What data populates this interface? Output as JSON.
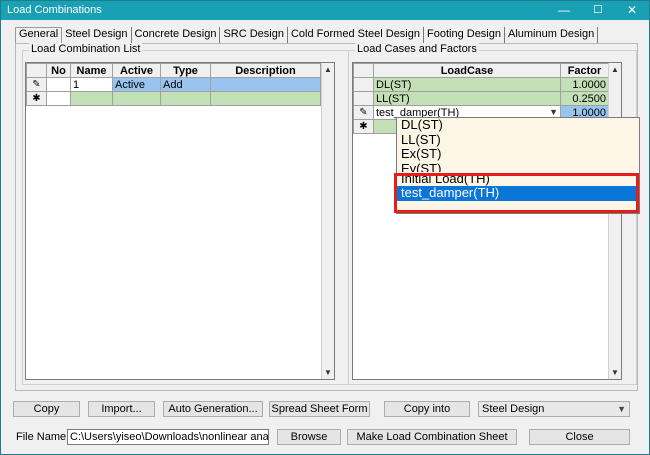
{
  "window": {
    "title": "Load Combinations"
  },
  "titlebar": {
    "minimize": "—",
    "maximize": "☐",
    "close": "✕"
  },
  "tabs": [
    {
      "label": "General"
    },
    {
      "label": "Steel Design"
    },
    {
      "label": "Concrete Design"
    },
    {
      "label": "SRC Design"
    },
    {
      "label": "Cold Formed Steel Design"
    },
    {
      "label": "Footing Design"
    },
    {
      "label": "Aluminum Design"
    }
  ],
  "left_panel": {
    "title": "Load Combination List",
    "headers": {
      "no": "No",
      "name": "Name",
      "active": "Active",
      "type": "Type",
      "description": "Description"
    },
    "rows": [
      {
        "marker": "✎",
        "no": "",
        "name": "1",
        "active": "Active",
        "type": "Add",
        "description": ""
      },
      {
        "marker": "✱",
        "no": "",
        "name": "",
        "active": "",
        "type": "",
        "description": ""
      }
    ]
  },
  "right_panel": {
    "title": "Load Cases and Factors",
    "headers": {
      "loadcase": "LoadCase",
      "factor": "Factor"
    },
    "rows": [
      {
        "marker": "",
        "loadcase": "DL(ST)",
        "factor": "1.0000"
      },
      {
        "marker": "",
        "loadcase": "LL(ST)",
        "factor": "0.2500"
      },
      {
        "marker": "✎",
        "loadcase": "test_damper(TH)",
        "factor": "1.0000"
      },
      {
        "marker": "✱",
        "loadcase": "",
        "factor": ""
      }
    ],
    "dropdown_options": [
      "DL(ST)",
      "LL(ST)",
      "Ex(ST)",
      "Ey(ST)",
      "Initial Load(TH)",
      "test_damper(TH)"
    ],
    "dropdown_selected": "test_damper(TH)"
  },
  "scroll": {
    "up": "▲",
    "down": "▼",
    "combo": "▼"
  },
  "buttons": {
    "copy": "Copy",
    "import": "Import...",
    "auto_generation": "Auto Generation...",
    "spreadsheet_form": "Spread Sheet Form",
    "copy_into": "Copy into",
    "browse": "Browse",
    "make_sheet": "Make Load Combination Sheet",
    "close": "Close"
  },
  "design_select": {
    "value": "Steel Design"
  },
  "file": {
    "label": "File Name:",
    "value": "C:\\Users\\yiseo\\Downloads\\nonlinear analys"
  }
}
